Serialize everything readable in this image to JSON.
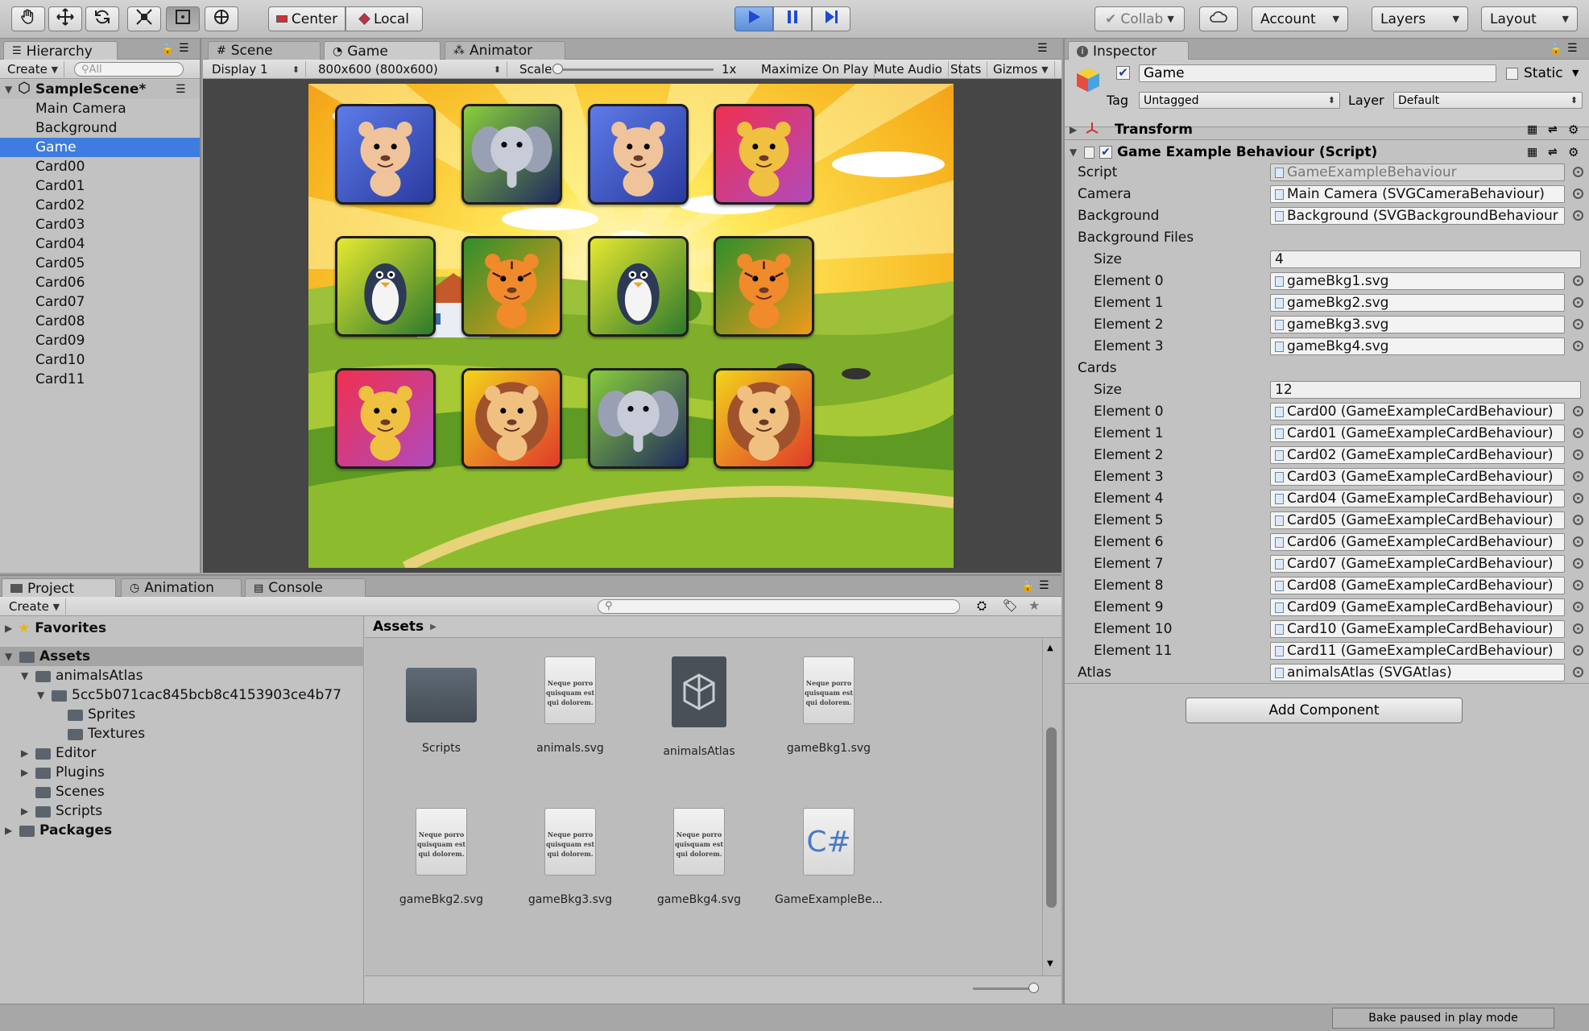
{
  "toolbar": {
    "pivot_label": "Center",
    "space_label": "Local",
    "collab_label": "Collab",
    "account_label": "Account",
    "layers_label": "Layers",
    "layout_label": "Layout"
  },
  "hierarchy": {
    "tab_label": "Hierarchy",
    "create_label": "Create",
    "search_placeholder": "All",
    "scene_name": "SampleScene*",
    "items": [
      "Main Camera",
      "Background",
      "Game",
      "Card00",
      "Card01",
      "Card02",
      "Card03",
      "Card04",
      "Card05",
      "Card06",
      "Card07",
      "Card08",
      "Card09",
      "Card10",
      "Card11"
    ],
    "selected": "Game"
  },
  "game_view": {
    "tabs": [
      "Scene",
      "Game",
      "Animator"
    ],
    "display": "Display 1",
    "resolution": "800x600 (800x600)",
    "scale_label": "Scale",
    "scale_value": "1x",
    "maximize_label": "Maximize On Play",
    "mute_label": "Mute Audio",
    "stats_label": "Stats",
    "gizmos_label": "Gizmos",
    "cards": [
      {
        "animal": "lion-cub",
        "bg": "blue"
      },
      {
        "animal": "elephant",
        "bg": "green-dark"
      },
      {
        "animal": "lion-cub",
        "bg": "blue"
      },
      {
        "animal": "leopard",
        "bg": "pink-red"
      },
      {
        "animal": "penguin",
        "bg": "green-yellow"
      },
      {
        "animal": "tiger",
        "bg": "olive-orange"
      },
      {
        "animal": "penguin",
        "bg": "green-yellow"
      },
      {
        "animal": "tiger",
        "bg": "olive-orange"
      },
      {
        "animal": "leopard",
        "bg": "pink-red"
      },
      {
        "animal": "lion",
        "bg": "orange-red"
      },
      {
        "animal": "elephant",
        "bg": "green-dark"
      },
      {
        "animal": "lion",
        "bg": "orange-red"
      }
    ]
  },
  "inspector": {
    "tab_label": "Inspector",
    "object_name": "Game",
    "static_label": "Static",
    "tag_label": "Tag",
    "tag_value": "Untagged",
    "layer_label": "Layer",
    "layer_value": "Default",
    "transform_label": "Transform",
    "script_component": "Game Example Behaviour (Script)",
    "script_label": "Script",
    "script_value": "GameExampleBehaviour",
    "camera_label": "Camera",
    "camera_value": "Main Camera (SVGCameraBehaviour)",
    "background_label": "Background",
    "background_value": "Background (SVGBackgroundBehaviour",
    "bg_files_label": "Background Files",
    "size_label": "Size",
    "bg_files_size": "4",
    "bg_files": [
      {
        "label": "Element 0",
        "value": "gameBkg1.svg"
      },
      {
        "label": "Element 1",
        "value": "gameBkg2.svg"
      },
      {
        "label": "Element 2",
        "value": "gameBkg3.svg"
      },
      {
        "label": "Element 3",
        "value": "gameBkg4.svg"
      }
    ],
    "cards_label": "Cards",
    "cards_size": "12",
    "cards": [
      {
        "label": "Element 0",
        "value": "Card00 (GameExampleCardBehaviour)"
      },
      {
        "label": "Element 1",
        "value": "Card01 (GameExampleCardBehaviour)"
      },
      {
        "label": "Element 2",
        "value": "Card02 (GameExampleCardBehaviour)"
      },
      {
        "label": "Element 3",
        "value": "Card03 (GameExampleCardBehaviour)"
      },
      {
        "label": "Element 4",
        "value": "Card04 (GameExampleCardBehaviour)"
      },
      {
        "label": "Element 5",
        "value": "Card05 (GameExampleCardBehaviour)"
      },
      {
        "label": "Element 6",
        "value": "Card06 (GameExampleCardBehaviour)"
      },
      {
        "label": "Element 7",
        "value": "Card07 (GameExampleCardBehaviour)"
      },
      {
        "label": "Element 8",
        "value": "Card08 (GameExampleCardBehaviour)"
      },
      {
        "label": "Element 9",
        "value": "Card09 (GameExampleCardBehaviour)"
      },
      {
        "label": "Element 10",
        "value": "Card10 (GameExampleCardBehaviour)"
      },
      {
        "label": "Element 11",
        "value": "Card11 (GameExampleCardBehaviour)"
      }
    ],
    "atlas_label": "Atlas",
    "atlas_value": "animalsAtlas (SVGAtlas)",
    "add_component_label": "Add Component"
  },
  "project": {
    "tabs": [
      "Project",
      "Animation",
      "Console"
    ],
    "create_label": "Create",
    "favorites_label": "Favorites",
    "assets_label": "Assets",
    "tree": [
      {
        "label": "animalsAtlas",
        "depth": 1,
        "arrow": "down"
      },
      {
        "label": "5cc5b071cac845bcb8c4153903ce4b77",
        "depth": 2,
        "arrow": "down"
      },
      {
        "label": "Sprites",
        "depth": 3,
        "arrow": ""
      },
      {
        "label": "Textures",
        "depth": 3,
        "arrow": ""
      },
      {
        "label": "Editor",
        "depth": 1,
        "arrow": "right"
      },
      {
        "label": "Plugins",
        "depth": 1,
        "arrow": "right"
      },
      {
        "label": "Scenes",
        "depth": 1,
        "arrow": ""
      },
      {
        "label": "Scripts",
        "depth": 1,
        "arrow": "right"
      }
    ],
    "packages_label": "Packages",
    "breadcrumb": "Assets",
    "assets": [
      {
        "name": "Scripts",
        "kind": "folder"
      },
      {
        "name": "animals.svg",
        "kind": "svg"
      },
      {
        "name": "animalsAtlas",
        "kind": "unity"
      },
      {
        "name": "gameBkg1.svg",
        "kind": "svg"
      },
      {
        "name": "gameBkg2.svg",
        "kind": "svg"
      },
      {
        "name": "gameBkg3.svg",
        "kind": "svg"
      },
      {
        "name": "gameBkg4.svg",
        "kind": "svg"
      },
      {
        "name": "GameExampleBe...",
        "kind": "cs"
      }
    ],
    "doc_preview_text": "Neque porro quisquam est qui dolorem.",
    "cs_label": "C#"
  },
  "status": {
    "message": "Bake paused in play mode"
  },
  "colors": {
    "selection": "#3e7ce1",
    "play_active": "#5e8fd8"
  }
}
